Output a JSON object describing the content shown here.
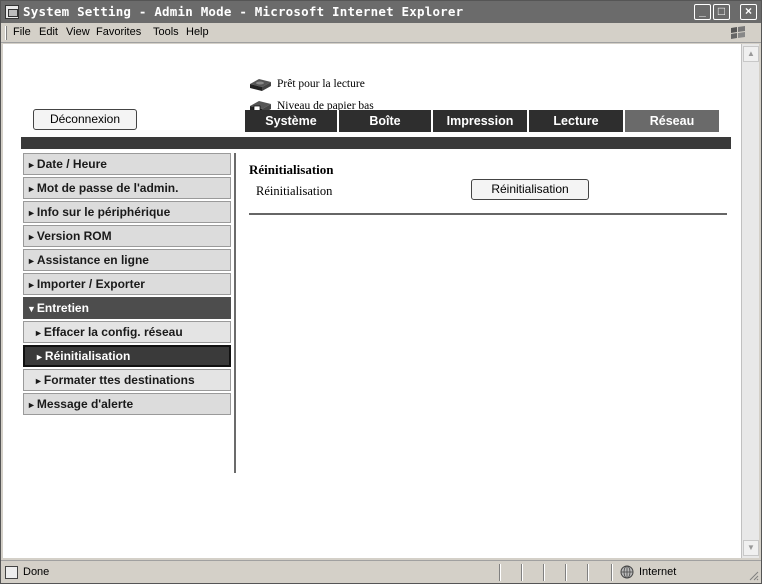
{
  "window": {
    "title": "System Setting - Admin Mode - Microsoft Internet Explorer",
    "minimize": "_",
    "maximize": "□",
    "close": "×"
  },
  "menu": {
    "items": [
      {
        "label": "File"
      },
      {
        "label": "Edit"
      },
      {
        "label": "View"
      },
      {
        "label": "Favorites"
      },
      {
        "label": "Tools"
      },
      {
        "label": "Help"
      }
    ]
  },
  "status_icons": {
    "ready": "Prêt pour la lecture",
    "paper_low": "Niveau de papier bas"
  },
  "logout": {
    "label": "Déconnexion"
  },
  "tabs": [
    {
      "label": "Système",
      "active": false
    },
    {
      "label": "Boîte",
      "active": false
    },
    {
      "label": "Impression",
      "active": false
    },
    {
      "label": "Lecture",
      "active": false
    },
    {
      "label": "Réseau",
      "active": true
    }
  ],
  "sidebar": {
    "items": [
      {
        "label": "Date / Heure",
        "arrow": "►"
      },
      {
        "label": "Mot de passe de l'admin.",
        "arrow": "►"
      },
      {
        "label": "Info sur le périphérique",
        "arrow": "►"
      },
      {
        "label": "Version ROM",
        "arrow": "►"
      },
      {
        "label": "Assistance en ligne",
        "arrow": "►"
      },
      {
        "label": "Importer / Exporter",
        "arrow": "►"
      },
      {
        "label": "Entretien",
        "arrow": "▼"
      },
      {
        "label": "Effacer la config. réseau",
        "arrow": "►"
      },
      {
        "label": "Réinitialisation",
        "arrow": "►"
      },
      {
        "label": "Formater ttes destinations",
        "arrow": "►"
      },
      {
        "label": "Message d'alerte",
        "arrow": "►"
      }
    ]
  },
  "main": {
    "title": "Réinitialisation",
    "setting_label": "Réinitialisation",
    "reset_button": "Réinitialisation"
  },
  "statusbar": {
    "status": "Done",
    "zone": "Internet"
  },
  "colors": {
    "titlebar": "#6b6b6b",
    "tab_inactive": "#2e2e2e",
    "tab_active": "#6a6a6a",
    "sidebar_expanded": "#4d4d4d",
    "sidebar_selected": "#3a3a3a"
  },
  "icons": [
    "ie-page-icon",
    "minimize-icon",
    "maximize-icon",
    "close-icon",
    "windows-logo-icon",
    "printer-icon",
    "printer-warning-icon",
    "done-page-icon",
    "internet-globe-icon",
    "resize-grip-icon"
  ]
}
